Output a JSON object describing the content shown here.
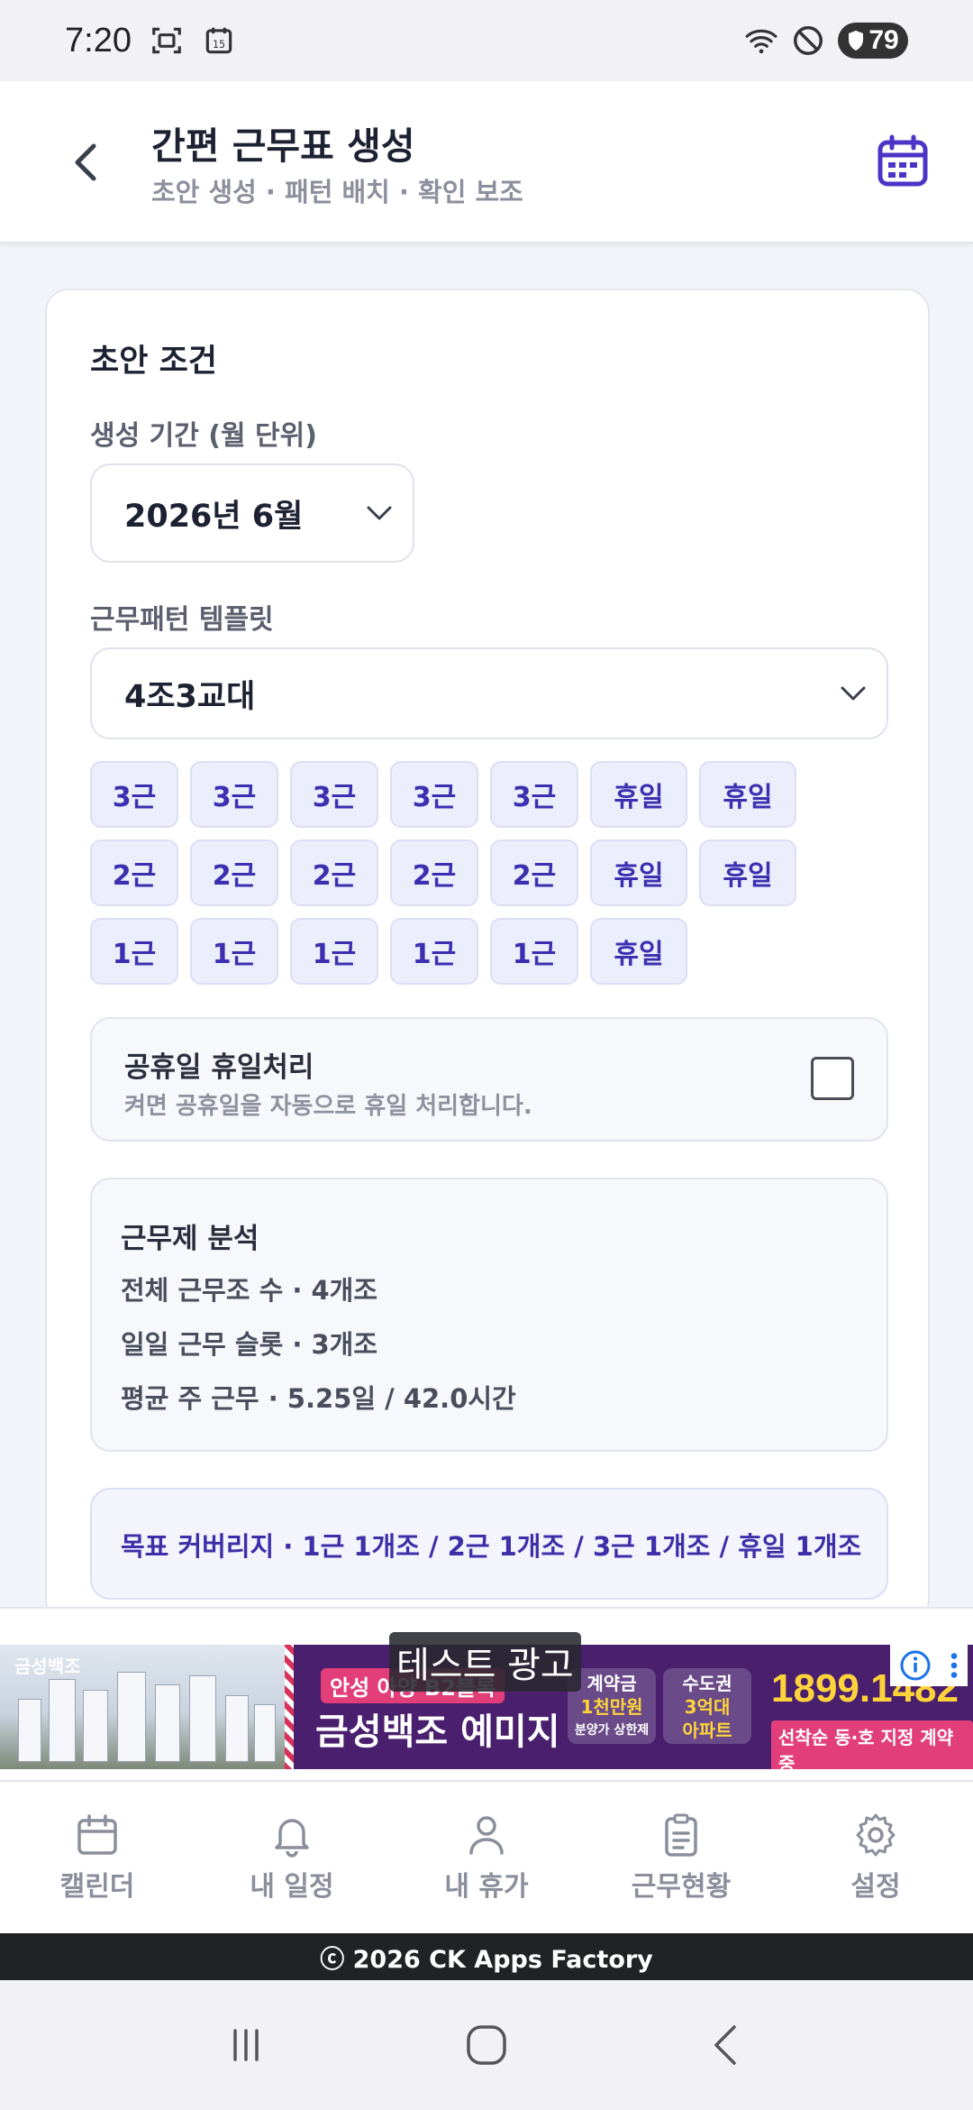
{
  "status_bar": {
    "time": "7:20",
    "battery": "79",
    "icons": [
      "screenshot-icon",
      "calendar-15-icon",
      "wifi-icon",
      "do-not-disturb-icon",
      "battery-icon"
    ]
  },
  "header": {
    "title": "간편 근무표 생성",
    "subtitle": "초안 생성 · 패턴 배치 · 확인 보조"
  },
  "form": {
    "section_title": "초안 조건",
    "period_label": "생성 기간 (월 단위)",
    "period_value": "2026년 6월",
    "template_label": "근무패턴 템플릿",
    "template_value": "4조3교대",
    "pattern_rows": [
      [
        "3근",
        "3근",
        "3근",
        "3근",
        "3근",
        "휴일",
        "휴일"
      ],
      [
        "2근",
        "2근",
        "2근",
        "2근",
        "2근",
        "휴일",
        "휴일"
      ],
      [
        "1근",
        "1근",
        "1근",
        "1근",
        "1근",
        "휴일"
      ]
    ],
    "holiday_toggle": {
      "title": "공휴일 휴일처리",
      "description": "켜면 공휴일을 자동으로 휴일 처리합니다.",
      "checked": false
    },
    "analysis": {
      "title": "근무제 분석",
      "lines": [
        "전체 근무조 수 · 4개조",
        "일일 근무 슬롯 · 3개조",
        "평균 주 근무 · 5.25일 / 42.0시간"
      ]
    },
    "coverage": "목표 커버리지 · 1근 1개조 / 2근 1개조 / 3근 1개조 / 휴일 1개조"
  },
  "ad": {
    "label": "테스트 광고",
    "logo": "금성백조",
    "tag": "안성 아양 B2블록",
    "brand": "금성백조 예미지",
    "badge1": [
      "계약금",
      "1천만원",
      "분양가 상한제"
    ],
    "badge2": [
      "수도권",
      "3억대",
      "아파트"
    ],
    "phone": "1899.1482",
    "phone_sub": "선착순 동·호 지정 계약중"
  },
  "bottom_nav": {
    "items": [
      {
        "label": "캘린더",
        "icon": "calendar-icon"
      },
      {
        "label": "내 일정",
        "icon": "bell-icon"
      },
      {
        "label": "내 휴가",
        "icon": "person-icon"
      },
      {
        "label": "근무현황",
        "icon": "clipboard-icon"
      },
      {
        "label": "설정",
        "icon": "gear-icon"
      }
    ]
  },
  "footer": "ⓒ 2026 CK Apps Factory",
  "colors": {
    "accent": "#4b34c6",
    "chip_bg": "#eceefc",
    "chip_text": "#3d2fb0",
    "page_bg": "#f3f4f9"
  }
}
